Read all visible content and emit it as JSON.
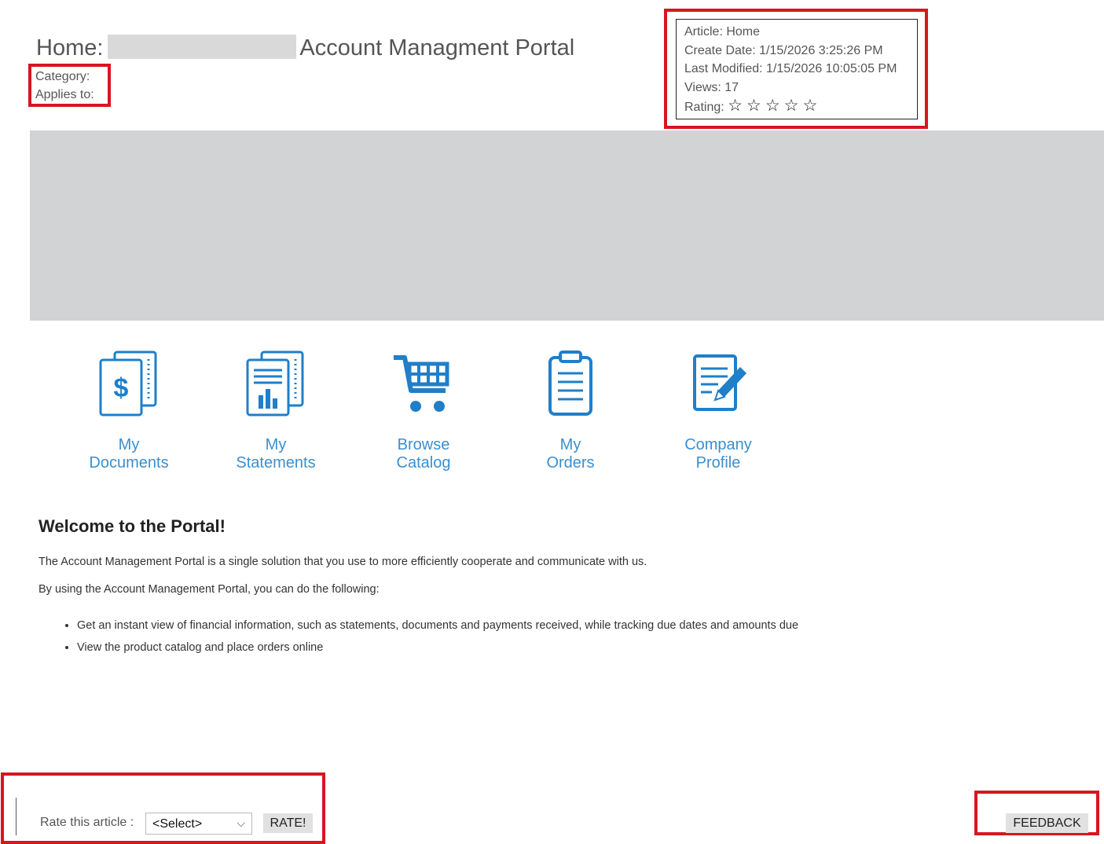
{
  "header": {
    "title_prefix": "Home:",
    "title_suffix": "Account Managment Portal",
    "category_label": "Category:",
    "applies_label": "Applies to:"
  },
  "article_info": {
    "article": "Article: Home",
    "create_date": "Create Date: 1/15/2026 3:25:26 PM",
    "last_modified": "Last Modified: 1/15/2026 10:05:05 PM",
    "views": "Views: 17",
    "rating_label": "Rating:",
    "rating_stars": [
      "☆",
      "☆",
      "☆",
      "☆",
      "☆"
    ],
    "rating_value": 0
  },
  "tiles": [
    {
      "line1": "My",
      "line2": "Documents",
      "icon": "documents-dollar-icon"
    },
    {
      "line1": "My",
      "line2": "Statements",
      "icon": "statements-chart-icon"
    },
    {
      "line1": "Browse",
      "line2": "Catalog",
      "icon": "shopping-cart-icon"
    },
    {
      "line1": "My",
      "line2": "Orders",
      "icon": "clipboard-icon"
    },
    {
      "line1": "Company",
      "line2": "Profile",
      "icon": "edit-document-icon"
    }
  ],
  "content": {
    "heading": "Welcome to the Portal!",
    "para1": "The Account Management Portal is a single solution that you use to more efficiently cooperate and communicate with us.",
    "para2": "By using the Account Management Portal, you can do the following:",
    "bullets": [
      "Get an instant view of financial information, such as statements, documents and payments received, while tracking due dates and amounts due",
      "View the product catalog and place orders online"
    ]
  },
  "footer": {
    "rate_label": "Rate this article :",
    "select_value": "<Select>",
    "rate_button": "RATE!",
    "feedback_button": "FEEDBACK"
  },
  "colors": {
    "accent_blue": "#1f7fc9",
    "tile_label_blue": "#3a8fd0",
    "highlight_red": "#d7161f",
    "banner_gray": "#d2d3d5"
  }
}
